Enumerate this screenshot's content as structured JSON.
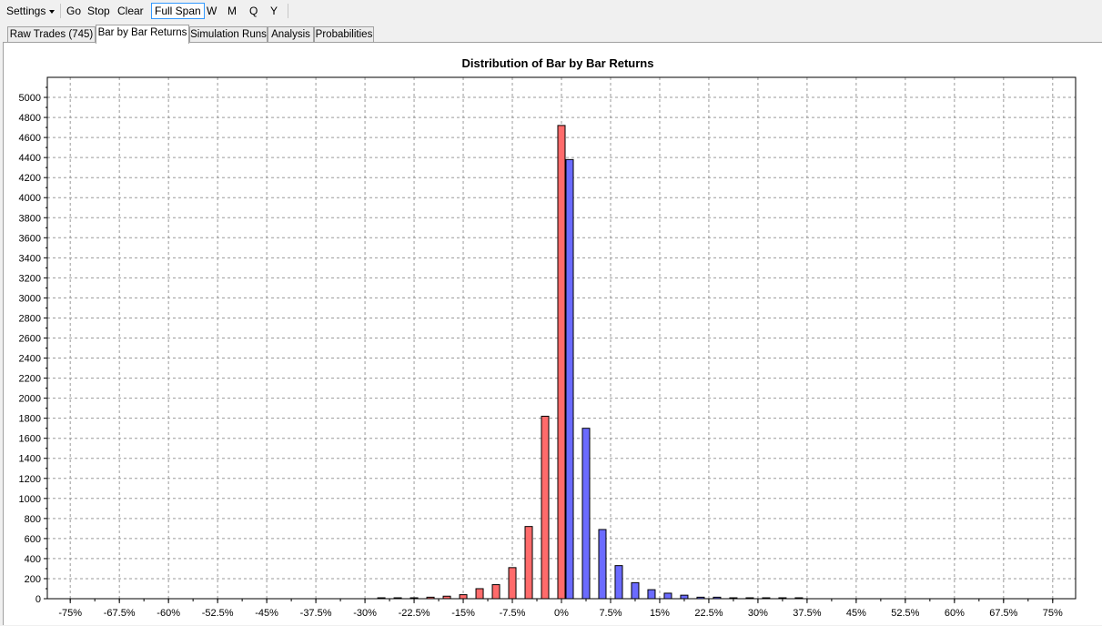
{
  "toolbar": {
    "settings": "Settings",
    "go": "Go",
    "stop": "Stop",
    "clear": "Clear",
    "full_span": "Full Span",
    "w": "W",
    "m": "M",
    "q": "Q",
    "y": "Y"
  },
  "tabs": [
    "Raw Trades (745)",
    "Bar by Bar Returns",
    "Simulation Runs",
    "Analysis",
    "Probabilities"
  ],
  "selected_tab": "Bar by Bar Returns",
  "colors": {
    "negative_bar": "#ff6b6b",
    "positive_bar": "#6b6bff"
  },
  "chart_data": {
    "type": "bar",
    "title": "Distribution of Bar by Bar Returns",
    "xlabel": "",
    "ylabel": "",
    "grid": true,
    "ylim": [
      0,
      5200
    ],
    "yticks": [
      0,
      200,
      400,
      600,
      800,
      1000,
      1200,
      1400,
      1600,
      1800,
      2000,
      2200,
      2400,
      2600,
      2800,
      3000,
      3200,
      3400,
      3600,
      3800,
      4000,
      4200,
      4400,
      4600,
      4800,
      5000
    ],
    "xlim": [
      -78.5,
      78.5
    ],
    "xticks": [
      -75,
      -67.5,
      -60,
      -52.5,
      -45,
      -37.5,
      -30,
      -22.5,
      -15,
      -7.5,
      0,
      7.5,
      15,
      22.5,
      30,
      37.5,
      45,
      52.5,
      60,
      67.5,
      75
    ],
    "xtick_labels": [
      "-75%",
      "-67.5%",
      "-60%",
      "-52.5%",
      "-45%",
      "-37.5%",
      "-30%",
      "-22.5%",
      "-15%",
      "-7.5%",
      "0%",
      "7.5%",
      "15%",
      "22.5%",
      "30%",
      "37.5%",
      "45%",
      "52.5%",
      "60%",
      "67.5%",
      "75%"
    ],
    "series": [
      {
        "color": "#ff6b6b",
        "x": [
          -27.5,
          -25,
          -22.5,
          -20,
          -17.5,
          -15,
          -12.5,
          -10,
          -7.5,
          -5,
          -2.5,
          0
        ],
        "values": [
          3,
          5,
          8,
          15,
          25,
          40,
          100,
          140,
          310,
          720,
          1820,
          4720
        ]
      },
      {
        "color": "#6b6bff",
        "x": [
          1.25,
          3.75,
          6.25,
          8.75,
          11.25,
          13.75,
          16.25,
          18.75,
          21.25,
          23.75,
          26.25,
          28.75,
          31.25,
          33.75,
          36.25
        ],
        "values": [
          4380,
          1700,
          690,
          330,
          160,
          90,
          55,
          35,
          15,
          15,
          8,
          4,
          3,
          2,
          5
        ]
      }
    ]
  }
}
